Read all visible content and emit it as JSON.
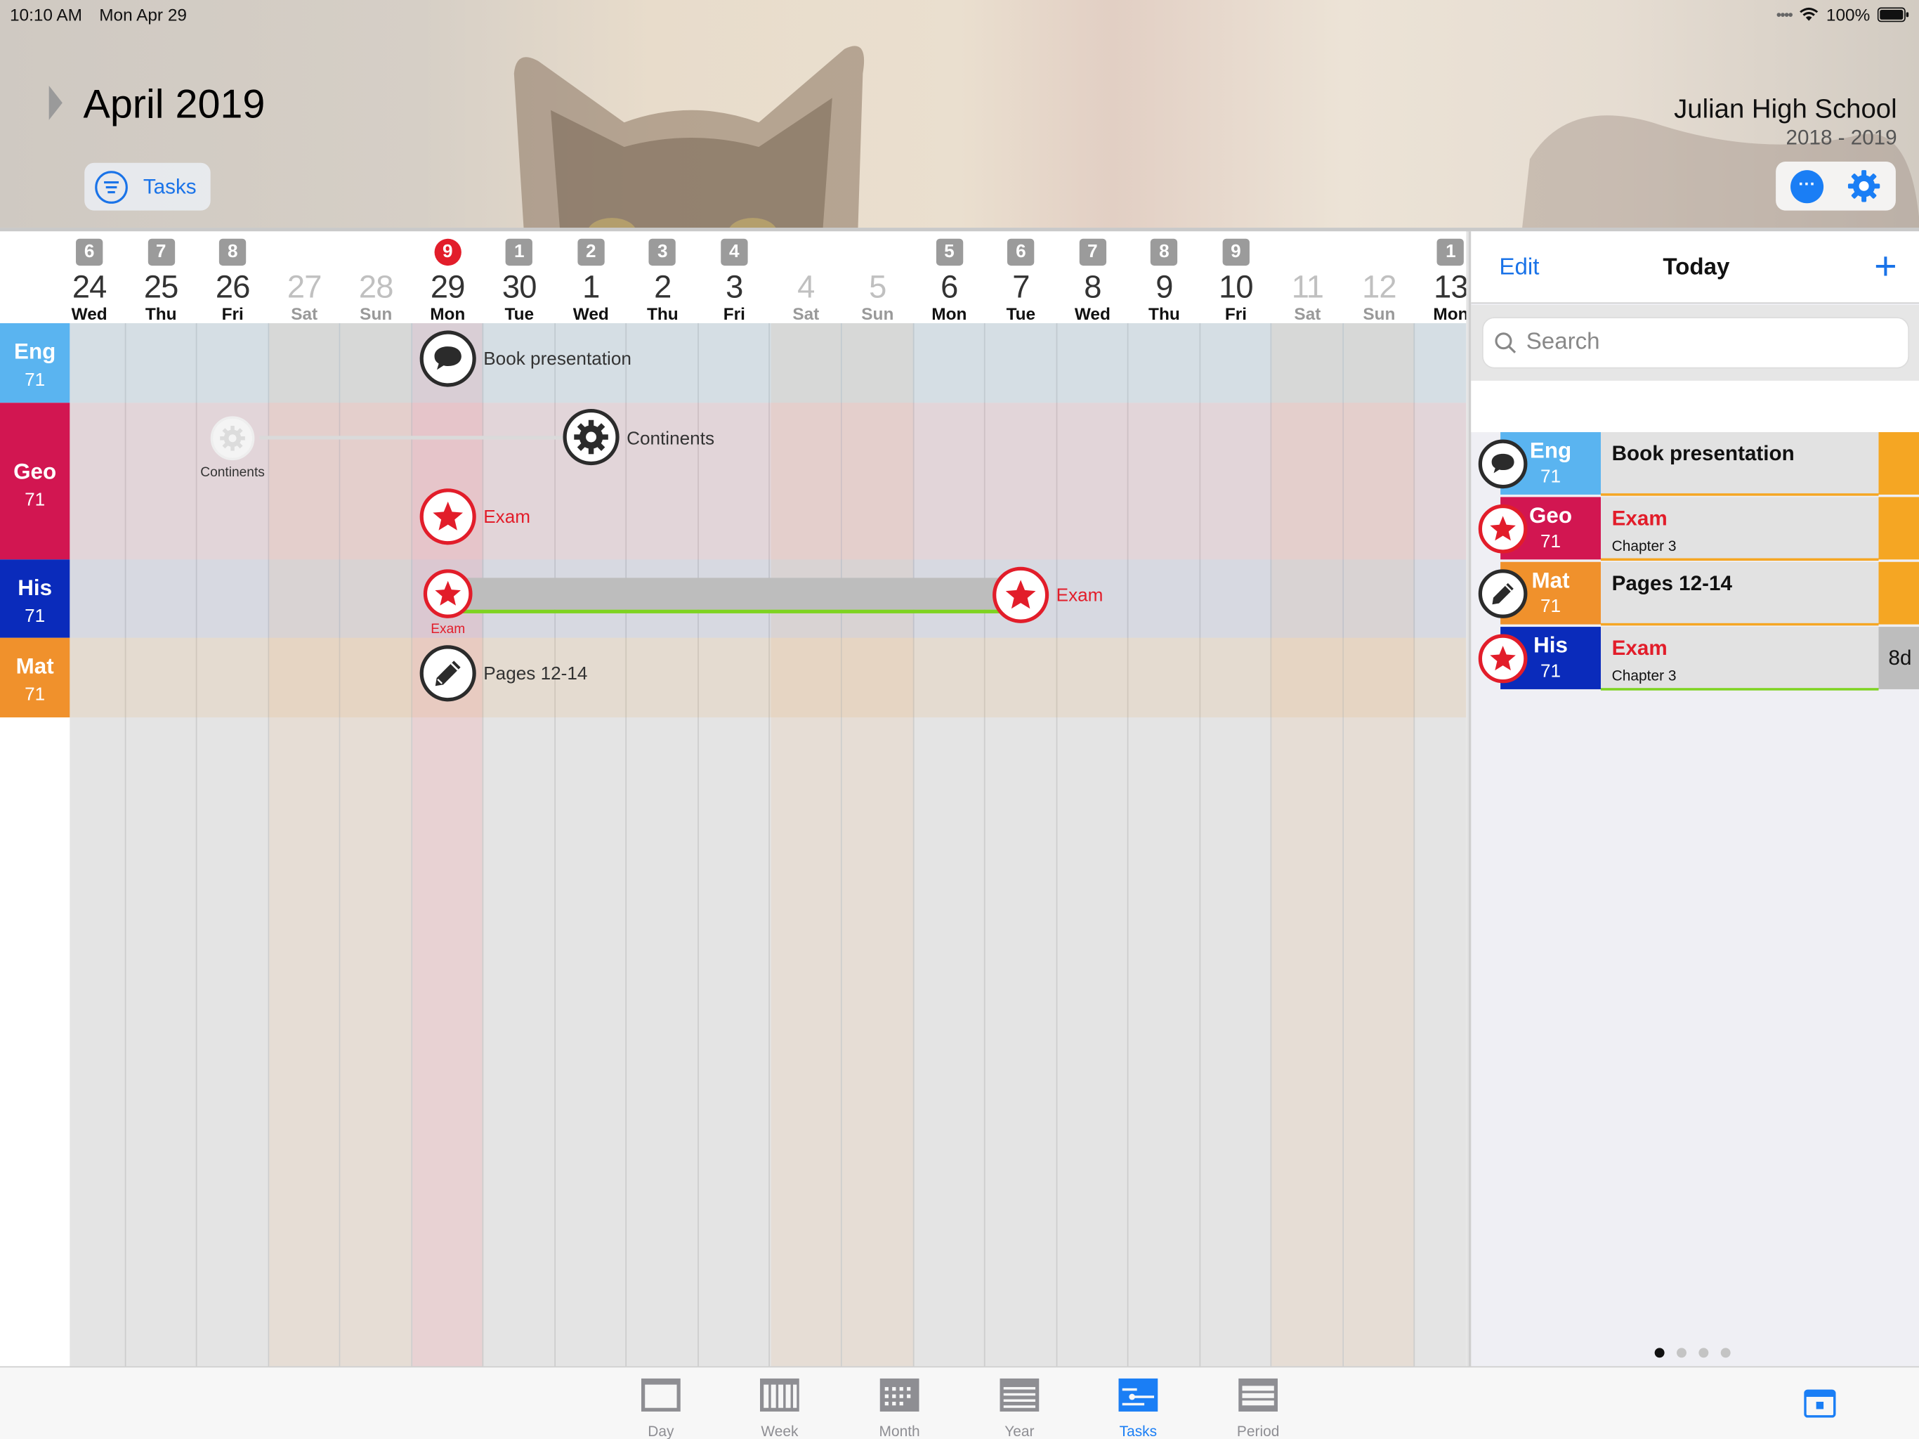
{
  "status_bar": {
    "time": "10:10 AM",
    "date": "Mon Apr 29",
    "battery": "100%"
  },
  "header": {
    "month_title": "April 2019",
    "filter_button_label": "Tasks",
    "school_name": "Julian High School",
    "school_year": "2018 - 2019"
  },
  "calendar": {
    "days": [
      {
        "week": "6",
        "date": "24",
        "day": "Wed"
      },
      {
        "week": "7",
        "date": "25",
        "day": "Thu"
      },
      {
        "week": "8",
        "date": "26",
        "day": "Fri"
      },
      {
        "week": "",
        "date": "27",
        "day": "Sat"
      },
      {
        "week": "",
        "date": "28",
        "day": "Sun"
      },
      {
        "week": "9",
        "date": "29",
        "day": "Mon"
      },
      {
        "week": "1",
        "date": "30",
        "day": "Tue"
      },
      {
        "week": "2",
        "date": "1",
        "day": "Wed"
      },
      {
        "week": "3",
        "date": "2",
        "day": "Thu"
      },
      {
        "week": "4",
        "date": "3",
        "day": "Fri"
      },
      {
        "week": "",
        "date": "4",
        "day": "Sat"
      },
      {
        "week": "",
        "date": "5",
        "day": "Sun"
      },
      {
        "week": "5",
        "date": "6",
        "day": "Mon"
      },
      {
        "week": "6",
        "date": "7",
        "day": "Tue"
      },
      {
        "week": "7",
        "date": "8",
        "day": "Wed"
      },
      {
        "week": "8",
        "date": "9",
        "day": "Thu"
      },
      {
        "week": "9",
        "date": "10",
        "day": "Fri"
      },
      {
        "week": "",
        "date": "11",
        "day": "Sat"
      },
      {
        "week": "",
        "date": "12",
        "day": "Sun"
      },
      {
        "week": "1",
        "date": "13",
        "day": "Mon"
      }
    ],
    "subjects": [
      {
        "code": "Eng",
        "number": "71",
        "color": "#5ab4f0"
      },
      {
        "code": "Geo",
        "number": "71",
        "color": "#d21651"
      },
      {
        "code": "His",
        "number": "71",
        "color": "#0a2bbb"
      },
      {
        "code": "Mat",
        "number": "71",
        "color": "#f0912c"
      }
    ],
    "tasks": {
      "eng_book": "Book presentation",
      "geo_continents_start": "Continents",
      "geo_continents": "Continents",
      "geo_exam": "Exam",
      "his_exam_start": "Exam",
      "his_exam": "Exam",
      "mat_pages": "Pages 12-14"
    }
  },
  "panel": {
    "edit_label": "Edit",
    "title": "Today",
    "add_label": "+",
    "search_placeholder": "Search",
    "items": [
      {
        "code": "Eng",
        "number": "71",
        "title": "Book presentation",
        "desc": "",
        "color": "#5ab4f0",
        "right": ""
      },
      {
        "code": "Geo",
        "number": "71",
        "title": "Exam",
        "desc": "Chapter 3",
        "color": "#d21651",
        "right": ""
      },
      {
        "code": "Mat",
        "number": "71",
        "title": "Pages 12-14",
        "desc": "",
        "color": "#f0912c",
        "right": ""
      },
      {
        "code": "His",
        "number": "71",
        "title": "Exam",
        "desc": "Chapter 3",
        "color": "#0a2bbb",
        "right": "8d"
      }
    ]
  },
  "tabbar": {
    "tabs": [
      {
        "label": "Day"
      },
      {
        "label": "Week"
      },
      {
        "label": "Month"
      },
      {
        "label": "Year"
      },
      {
        "label": "Tasks"
      },
      {
        "label": "Period"
      }
    ],
    "active": "Tasks"
  },
  "colors": {
    "accent": "#1a7ef5",
    "exam_red": "#e21d2a",
    "deadline_orange": "#f5a623",
    "progress_green": "#7ed321"
  }
}
